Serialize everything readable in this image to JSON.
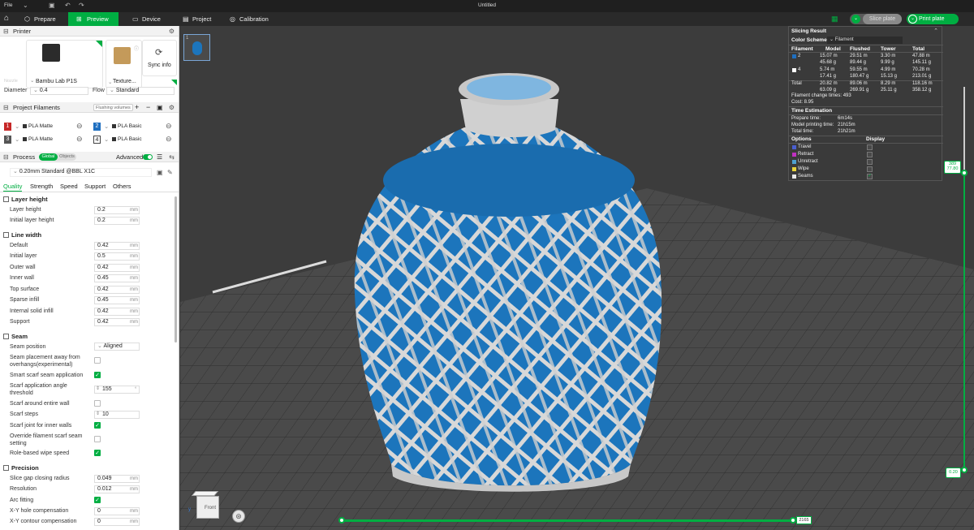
{
  "titlebar": {
    "file": "File",
    "title": "Untitled"
  },
  "tabs": [
    {
      "label": "Prepare",
      "icon": "cube-icon"
    },
    {
      "label": "Preview",
      "icon": "preview-icon"
    },
    {
      "label": "Device",
      "icon": "monitor-icon"
    },
    {
      "label": "Project",
      "icon": "project-icon"
    },
    {
      "label": "Calibration",
      "icon": "calibration-icon"
    }
  ],
  "actions": {
    "slice": "Slice plate",
    "print": "Print plate"
  },
  "printer": {
    "section": "Printer",
    "name": "Bambu Lab P1S",
    "plate": "Texture...",
    "sync": "Sync info",
    "nozzle_label": "Nozzle",
    "diameter_label": "Diameter",
    "diameter": "0.4",
    "flow_label": "Flow",
    "flow": "Standard"
  },
  "filaments": {
    "section": "Project Filaments",
    "flushing": "Flushing volumes",
    "items": [
      {
        "num": "1",
        "name": "PLA Matte",
        "color": "#c62828"
      },
      {
        "num": "2",
        "name": "PLA Basic",
        "color": "#1f6fc0"
      },
      {
        "num": "3",
        "name": "PLA Matte",
        "color": "#555555"
      },
      {
        "num": "4",
        "name": "PLA Basic",
        "color": "#ffffff"
      }
    ]
  },
  "process": {
    "section": "Process",
    "global": "Global",
    "objects": "Objects",
    "advanced": "Advanced",
    "preset": "0.20mm Standard @BBL X1C",
    "subtabs": [
      "Quality",
      "Strength",
      "Speed",
      "Support",
      "Others"
    ]
  },
  "groups": {
    "layer_height": {
      "title": "Layer height",
      "rows": [
        {
          "label": "Layer height",
          "value": "0.2",
          "unit": "mm"
        },
        {
          "label": "Initial layer height",
          "value": "0.2",
          "unit": "mm"
        }
      ]
    },
    "line_width": {
      "title": "Line width",
      "rows": [
        {
          "label": "Default",
          "value": "0.42",
          "unit": "mm"
        },
        {
          "label": "Initial layer",
          "value": "0.5",
          "unit": "mm"
        },
        {
          "label": "Outer wall",
          "value": "0.42",
          "unit": "mm"
        },
        {
          "label": "Inner wall",
          "value": "0.45",
          "unit": "mm"
        },
        {
          "label": "Top surface",
          "value": "0.42",
          "unit": "mm"
        },
        {
          "label": "Sparse infill",
          "value": "0.45",
          "unit": "mm"
        },
        {
          "label": "Internal solid infill",
          "value": "0.42",
          "unit": "mm"
        },
        {
          "label": "Support",
          "value": "0.42",
          "unit": "mm"
        }
      ]
    },
    "seam": {
      "title": "Seam",
      "position_label": "Seam position",
      "position": "Aligned",
      "away_label_1": "Seam placement away from",
      "away_label_2": "overhangs(experimental)",
      "smart_label": "Smart scarf seam application",
      "angle_label_1": "Scarf application angle",
      "angle_label_2": "threshold",
      "angle": "155",
      "angle_unit": "°",
      "around_label": "Scarf around entire wall",
      "steps_label": "Scarf steps",
      "steps": "10",
      "inner_label": "Scarf joint for inner walls",
      "override_label_1": "Override filament scarf seam",
      "override_label_2": "setting",
      "role_label": "Role-based wipe speed"
    },
    "precision": {
      "title": "Precision",
      "rows": [
        {
          "label": "Slice gap closing radius",
          "value": "0.049",
          "unit": "mm"
        },
        {
          "label": "Resolution",
          "value": "0.012",
          "unit": "mm"
        },
        {
          "label": "Arc fitting",
          "value": "",
          "unit": ""
        },
        {
          "label": "X-Y hole compensation",
          "value": "0",
          "unit": "mm"
        },
        {
          "label": "X-Y contour compensation",
          "value": "0",
          "unit": "mm"
        }
      ]
    }
  },
  "slicing": {
    "title": "Slicing Result",
    "scheme_label": "Color Scheme",
    "scheme": "Filament",
    "columns": [
      "Filament",
      "Model",
      "Flushed",
      "Tower",
      "Total"
    ],
    "rows": [
      {
        "id": "2",
        "color": "#1f6fc0",
        "model": [
          "15.07 m",
          "45.68 g"
        ],
        "flushed": [
          "29.51 m",
          "89.44 g"
        ],
        "tower": [
          "3.30 m",
          "9.99 g"
        ],
        "total": [
          "47.88 m",
          "145.11 g"
        ]
      },
      {
        "id": "4",
        "color": "#ffffff",
        "model": [
          "5.74 m",
          "17.41 g"
        ],
        "flushed": [
          "59.55 m",
          "180.47 g"
        ],
        "tower": [
          "4.99 m",
          "15.13 g"
        ],
        "total": [
          "70.28 m",
          "213.01 g"
        ]
      },
      {
        "id": "Total",
        "color": "",
        "model": [
          "20.82 m",
          "63.09 g"
        ],
        "flushed": [
          "89.06 m",
          "269.91 g"
        ],
        "tower": [
          "8.29 m",
          "25.11 g"
        ],
        "total": [
          "118.16 m",
          "358.12 g"
        ]
      }
    ],
    "changes": "Filament change times: 493",
    "cost": "Cost: 8.95",
    "time_title": "Time Estimation",
    "prepare_label": "Prepare time:",
    "prepare": "6m14s",
    "model_label": "Model printing time:",
    "model_time": "21h15m",
    "total_label": "Total time:",
    "total_time": "21h21m",
    "options_label": "Options",
    "display_label": "Display",
    "options": [
      {
        "label": "Travel",
        "color": "#4a5fd0",
        "on": false
      },
      {
        "label": "Retract",
        "color": "#c030c0",
        "on": false
      },
      {
        "label": "Unretract",
        "color": "#4fa0d0",
        "on": false
      },
      {
        "label": "Wipe",
        "color": "#e8d23a",
        "on": false
      },
      {
        "label": "Seams",
        "color": "#e8e8e8",
        "on": true
      }
    ]
  },
  "layer_slider": {
    "top_layer": "389",
    "top_height": "77.80",
    "bottom": "0.20"
  },
  "move_slider": {
    "value": "2165"
  },
  "plate_thumb": {
    "num": "1"
  },
  "navcube": {
    "front": "Front"
  }
}
